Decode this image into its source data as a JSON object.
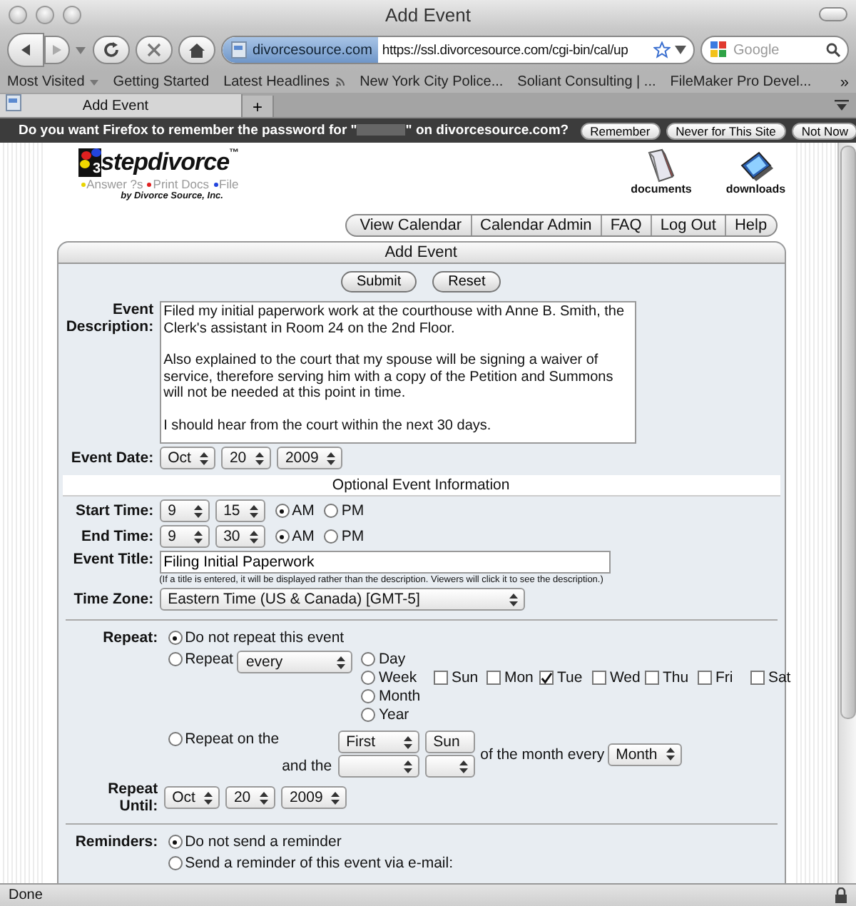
{
  "browser": {
    "title": "Add Event",
    "site_badge": "divorcesource.com",
    "url": "https://ssl.divorcesource.com/cgi-bin/cal/up",
    "search_placeholder": "Google",
    "bookmarks": [
      {
        "label": "Most Visited",
        "kind": "menu"
      },
      {
        "label": "Getting Started",
        "kind": "link"
      },
      {
        "label": "Latest Headlines",
        "kind": "feed"
      },
      {
        "label": "New York City Police...",
        "kind": "link"
      },
      {
        "label": "Soliant Consulting | ...",
        "kind": "link"
      },
      {
        "label": "FileMaker Pro Devel...",
        "kind": "link"
      }
    ],
    "overflow": "»",
    "tabs": [
      {
        "title": "Add Event",
        "selected": true
      }
    ],
    "new_tab": "+"
  },
  "password_bar": {
    "message_start": "Do you want Firefox to remember the password for \"",
    "message_end": "\" on divorcesource.com?",
    "buttons": [
      "Remember",
      "Never for This Site",
      "Not Now"
    ]
  },
  "site": {
    "logo_mark": "3",
    "logo_text": "stepdivorce",
    "trademark": "™",
    "tagline": [
      {
        "text": "Answer ?s",
        "color": "#e8d400"
      },
      {
        "text": "Print Docs",
        "color": "#e02020"
      },
      {
        "text": "File",
        "color": "#2244dd"
      }
    ],
    "byline": "by Divorce Source, Inc.",
    "shortcuts": [
      {
        "label": "documents",
        "kind": "book"
      },
      {
        "label": "downloads",
        "kind": "computer"
      }
    ],
    "nav": [
      "View Calendar",
      "Calendar Admin",
      "FAQ",
      "Log Out",
      "Help"
    ]
  },
  "form": {
    "title": "Add Event",
    "actions": [
      "Submit",
      "Reset"
    ],
    "description": {
      "label": "Event Description:",
      "paragraphs": [
        "Filed my initial paperwork work at the courthouse with Anne B. Smith, the Clerk's assistant in Room 24 on the 2nd Floor.",
        "Also explained to the court that my spouse will be signing a waiver of service, therefore serving him with a copy of the Petition and Summons will not be needed at this point in time.",
        "I should hear from the court within the next 30 days."
      ]
    },
    "event_date": {
      "label": "Event Date:",
      "selects": [
        "Oct",
        "20",
        "2009"
      ]
    },
    "section": "Optional Event Information",
    "times": [
      {
        "label": "Start Time:",
        "selects": [
          "9",
          "15"
        ],
        "periods": [
          {
            "label": "AM",
            "selected": true
          },
          {
            "label": "PM",
            "selected": false
          }
        ]
      },
      {
        "label": "End Time:",
        "selects": [
          "9",
          "30"
        ],
        "periods": [
          {
            "label": "AM",
            "selected": true
          },
          {
            "label": "PM",
            "selected": false
          }
        ]
      }
    ],
    "event_title": {
      "label": "Event Title:",
      "value": "Filing Initial Paperwork",
      "hint": "(If a title is entered, it will be displayed rather than the description. Viewers will click it to see the description.)"
    },
    "time_zone": {
      "label": "Time Zone:",
      "value": "Eastern Time (US & Canada) [GMT-5]"
    },
    "repeat": {
      "label": "Repeat:",
      "no_repeat": {
        "label": "Do not repeat this event",
        "selected": true
      },
      "every": {
        "label": "Repeat",
        "selected": false,
        "interval": "every",
        "units": [
          {
            "label": "Day",
            "selected": false
          },
          {
            "label": "Week",
            "selected": false
          },
          {
            "label": "Month",
            "selected": false
          },
          {
            "label": "Year",
            "selected": false
          }
        ]
      },
      "weekdays": [
        {
          "label": "Sun",
          "checked": false
        },
        {
          "label": "Mon",
          "checked": false
        },
        {
          "label": "Tue",
          "checked": true
        },
        {
          "label": "Wed",
          "checked": false
        },
        {
          "label": "Thu",
          "checked": false
        },
        {
          "label": "Fri",
          "checked": false
        },
        {
          "label": "Sat",
          "checked": false
        }
      ],
      "on_the": {
        "label": "Repeat on the",
        "selected": false,
        "selects": [
          "First",
          "Sun"
        ],
        "and_label": "and the",
        "of_label": "of the month every",
        "period": "Month"
      }
    },
    "repeat_until": {
      "label": "Repeat Until:",
      "selects": [
        "Oct",
        "20",
        "2009"
      ]
    },
    "reminders": {
      "label": "Reminders:",
      "options": [
        {
          "label": "Do not send a reminder",
          "selected": true
        },
        {
          "label": "Send a reminder of this event via e-mail:",
          "selected": false
        }
      ]
    }
  },
  "status_bar": {
    "text": "Done"
  }
}
